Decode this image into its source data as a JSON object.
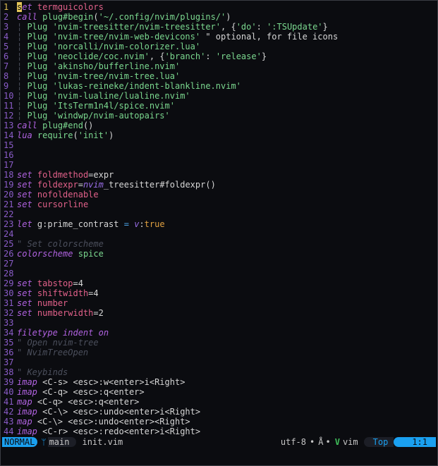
{
  "editor": {
    "lines": [
      {
        "n": "1",
        "current": true,
        "tokens": [
          [
            "cursor",
            "s"
          ],
          [
            "keyword",
            "et"
          ],
          [
            "text",
            " "
          ],
          [
            "opt",
            "termguicolors"
          ]
        ]
      },
      {
        "n": "2",
        "tokens": [
          [
            "keyword",
            "call"
          ],
          [
            "text",
            " "
          ],
          [
            "func",
            "plug#begin"
          ],
          [
            "punct",
            "("
          ],
          [
            "string",
            "'~/.config/nvim/plugins/'"
          ],
          [
            "punct",
            ")"
          ]
        ]
      },
      {
        "n": "3",
        "tokens": [
          [
            "guide",
            "¦ "
          ],
          [
            "func",
            "Plug"
          ],
          [
            "text",
            " "
          ],
          [
            "string",
            "'nvim-treesitter/nvim-treesitter'"
          ],
          [
            "punct",
            ", {"
          ],
          [
            "string",
            "'do'"
          ],
          [
            "punct",
            ": "
          ],
          [
            "string",
            "':TSUpdate'"
          ],
          [
            "punct",
            "}"
          ]
        ]
      },
      {
        "n": "4",
        "tokens": [
          [
            "guide",
            "¦ "
          ],
          [
            "func",
            "Plug"
          ],
          [
            "text",
            " "
          ],
          [
            "string",
            "'nvim-tree/nvim-web-devicons'"
          ],
          [
            "text",
            " \" optional, for file icons"
          ]
        ]
      },
      {
        "n": "5",
        "tokens": [
          [
            "guide",
            "¦ "
          ],
          [
            "func",
            "Plug"
          ],
          [
            "text",
            " "
          ],
          [
            "string",
            "'norcalli/nvim-colorizer.lua'"
          ]
        ]
      },
      {
        "n": "6",
        "tokens": [
          [
            "guide",
            "¦ "
          ],
          [
            "func",
            "Plug"
          ],
          [
            "text",
            " "
          ],
          [
            "string",
            "'neoclide/coc.nvim'"
          ],
          [
            "punct",
            ", {"
          ],
          [
            "string",
            "'branch'"
          ],
          [
            "punct",
            ": "
          ],
          [
            "string",
            "'release'"
          ],
          [
            "punct",
            "}"
          ]
        ]
      },
      {
        "n": "7",
        "tokens": [
          [
            "guide",
            "¦ "
          ],
          [
            "func",
            "Plug"
          ],
          [
            "text",
            " "
          ],
          [
            "string",
            "'akinsho/bufferline.nvim'"
          ]
        ]
      },
      {
        "n": "8",
        "tokens": [
          [
            "guide",
            "¦ "
          ],
          [
            "func",
            "Plug"
          ],
          [
            "text",
            " "
          ],
          [
            "string",
            "'nvim-tree/nvim-tree.lua'"
          ]
        ]
      },
      {
        "n": "9",
        "tokens": [
          [
            "guide",
            "¦ "
          ],
          [
            "func",
            "Plug"
          ],
          [
            "text",
            " "
          ],
          [
            "string",
            "'lukas-reineke/indent-blankline.nvim'"
          ]
        ]
      },
      {
        "n": "10",
        "tokens": [
          [
            "guide",
            "¦ "
          ],
          [
            "func",
            "Plug"
          ],
          [
            "text",
            " "
          ],
          [
            "string",
            "'nvim-lualine/lualine.nvim'"
          ]
        ]
      },
      {
        "n": "11",
        "tokens": [
          [
            "guide",
            "¦ "
          ],
          [
            "func",
            "Plug"
          ],
          [
            "text",
            " "
          ],
          [
            "string",
            "'ItsTerm1n4l/spice.nvim'"
          ]
        ]
      },
      {
        "n": "12",
        "tokens": [
          [
            "guide",
            "¦ "
          ],
          [
            "func",
            "Plug"
          ],
          [
            "text",
            " "
          ],
          [
            "string",
            "'windwp/nvim-autopairs'"
          ]
        ]
      },
      {
        "n": "13",
        "tokens": [
          [
            "keyword",
            "call"
          ],
          [
            "text",
            " "
          ],
          [
            "func",
            "plug#end"
          ],
          [
            "punct",
            "()"
          ]
        ]
      },
      {
        "n": "14",
        "tokens": [
          [
            "keyword",
            "lua"
          ],
          [
            "text",
            " "
          ],
          [
            "func",
            "require"
          ],
          [
            "punct",
            "("
          ],
          [
            "string",
            "'init'"
          ],
          [
            "punct",
            ")"
          ]
        ]
      },
      {
        "n": "15",
        "tokens": []
      },
      {
        "n": "16",
        "tokens": []
      },
      {
        "n": "17",
        "tokens": []
      },
      {
        "n": "18",
        "tokens": [
          [
            "keyword",
            "set"
          ],
          [
            "text",
            " "
          ],
          [
            "opt",
            "foldmethod"
          ],
          [
            "punct",
            "="
          ],
          [
            "text",
            "expr"
          ]
        ]
      },
      {
        "n": "19",
        "tokens": [
          [
            "keyword",
            "set"
          ],
          [
            "text",
            " "
          ],
          [
            "opt",
            "foldexpr"
          ],
          [
            "punct",
            "="
          ],
          [
            "scope",
            "nvim"
          ],
          [
            "text",
            "_treesitter#foldexpr()"
          ]
        ]
      },
      {
        "n": "20",
        "tokens": [
          [
            "keyword",
            "set"
          ],
          [
            "text",
            " "
          ],
          [
            "opt",
            "nofoldenable"
          ]
        ]
      },
      {
        "n": "21",
        "tokens": [
          [
            "keyword",
            "set"
          ],
          [
            "text",
            " "
          ],
          [
            "opt",
            "cursorline"
          ]
        ]
      },
      {
        "n": "22",
        "tokens": []
      },
      {
        "n": "23",
        "tokens": [
          [
            "keyword",
            "let"
          ],
          [
            "text",
            " g:prime_contrast "
          ],
          [
            "op",
            "="
          ],
          [
            "text",
            " "
          ],
          [
            "scope",
            "v"
          ],
          [
            "text",
            ":"
          ],
          [
            "bool",
            "true"
          ]
        ]
      },
      {
        "n": "24",
        "tokens": []
      },
      {
        "n": "25",
        "tokens": [
          [
            "comment",
            "\" Set colorscheme"
          ]
        ]
      },
      {
        "n": "26",
        "tokens": [
          [
            "keyword",
            "colorscheme"
          ],
          [
            "text",
            " "
          ],
          [
            "string",
            "spice"
          ]
        ]
      },
      {
        "n": "27",
        "tokens": []
      },
      {
        "n": "28",
        "tokens": []
      },
      {
        "n": "29",
        "tokens": [
          [
            "keyword",
            "set"
          ],
          [
            "text",
            " "
          ],
          [
            "opt",
            "tabstop"
          ],
          [
            "punct",
            "="
          ],
          [
            "number",
            "4"
          ]
        ]
      },
      {
        "n": "30",
        "tokens": [
          [
            "keyword",
            "set"
          ],
          [
            "text",
            " "
          ],
          [
            "opt",
            "shiftwidth"
          ],
          [
            "punct",
            "="
          ],
          [
            "number",
            "4"
          ]
        ]
      },
      {
        "n": "31",
        "tokens": [
          [
            "keyword",
            "set"
          ],
          [
            "text",
            " "
          ],
          [
            "opt",
            "number"
          ]
        ]
      },
      {
        "n": "32",
        "tokens": [
          [
            "keyword",
            "set"
          ],
          [
            "text",
            " "
          ],
          [
            "opt",
            "numberwidth"
          ],
          [
            "punct",
            "="
          ],
          [
            "number",
            "2"
          ]
        ]
      },
      {
        "n": "33",
        "tokens": []
      },
      {
        "n": "34",
        "tokens": [
          [
            "keyword",
            "filetype"
          ],
          [
            "text",
            " "
          ],
          [
            "keyword",
            "indent"
          ],
          [
            "text",
            " "
          ],
          [
            "keyword",
            "on"
          ]
        ]
      },
      {
        "n": "35",
        "tokens": [
          [
            "comment",
            "\" Open nvim-tree"
          ]
        ]
      },
      {
        "n": "36",
        "tokens": [
          [
            "comment",
            "\" NvimTreeOpen"
          ]
        ]
      },
      {
        "n": "37",
        "tokens": []
      },
      {
        "n": "38",
        "tokens": [
          [
            "comment",
            "\" Keybinds"
          ]
        ]
      },
      {
        "n": "39",
        "tokens": [
          [
            "keyword",
            "imap"
          ],
          [
            "text",
            " <C-s> <esc>:w<enter>i<Right>"
          ]
        ]
      },
      {
        "n": "40",
        "tokens": [
          [
            "keyword",
            "imap"
          ],
          [
            "text",
            " <C-q> <esc>:q<enter>"
          ]
        ]
      },
      {
        "n": "41",
        "tokens": [
          [
            "keyword",
            "map"
          ],
          [
            "text",
            " <C-q> <esc>:q<enter>"
          ]
        ]
      },
      {
        "n": "42",
        "tokens": [
          [
            "keyword",
            "imap"
          ],
          [
            "text",
            " <C-\\> <esc>:undo<enter>i<Right>"
          ]
        ]
      },
      {
        "n": "43",
        "tokens": [
          [
            "keyword",
            "map"
          ],
          [
            "text",
            " <C-\\> <esc>:undo<enter><Right>"
          ]
        ]
      },
      {
        "n": "44",
        "tokens": [
          [
            "keyword",
            "imap"
          ],
          [
            "text",
            " <C-r> <esc>:redo<enter>i<Right>"
          ]
        ]
      }
    ]
  },
  "statusline": {
    "mode": "NORMAL",
    "branch_icon": "ᛘ",
    "branch": "main",
    "filename": "init.vim",
    "encoding": "utf-8",
    "dot1": "•",
    "os_icon": "Å",
    "dot2": "•",
    "filetype_icon": "V",
    "filetype": "vim",
    "position": "Top",
    "location": "1:1"
  },
  "colors": {
    "accent": "#1aa0f0",
    "linenr": "#8a5cc8",
    "current_linenr": "#e0c050",
    "string": "#7bd88f",
    "option": "#e2618a",
    "keyword": "#b062e0",
    "comment": "#4b4f5c"
  }
}
